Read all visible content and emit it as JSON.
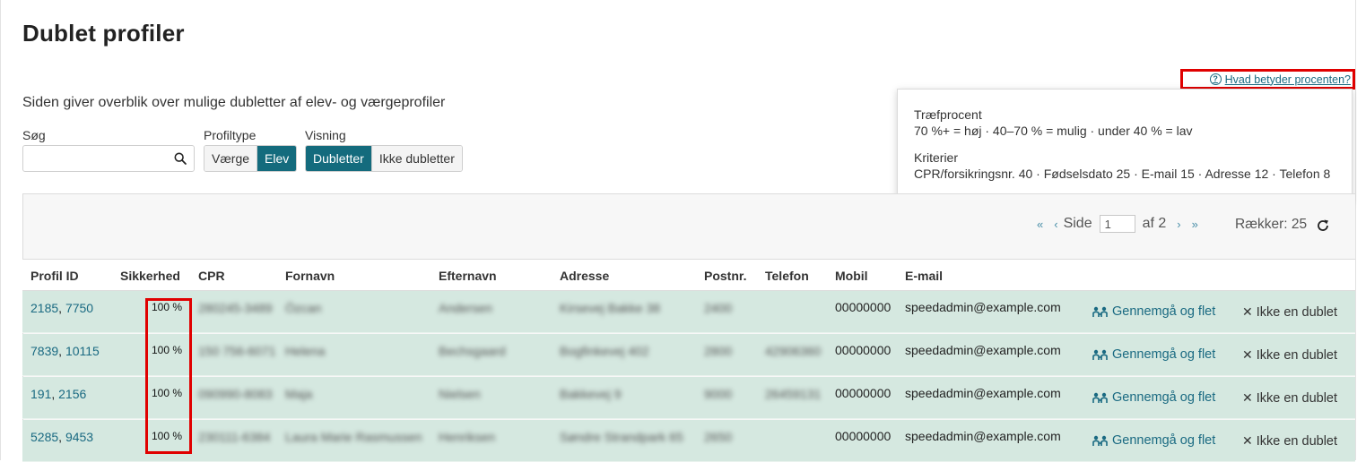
{
  "page": {
    "title": "Dublet profiler",
    "intro": "Siden giver overblik over mulige dubletter af elev- og værgeprofiler",
    "help_link": "Hvad betyder procenten?"
  },
  "tooltip": {
    "heading1": "Træfprocent",
    "line1": "70 %+ = høj · 40–70 % = mulig · under 40 % = lav",
    "heading2": "Kriterier",
    "line2": "CPR/forsikringsnr. 40 · Fødselsdato 25 · E-mail 15 · Adresse 12 · Telefon 8"
  },
  "filters": {
    "search_label": "Søg",
    "search_value": "",
    "profiletype_label": "Profiltype",
    "profiletype_options": [
      "Værge",
      "Elev"
    ],
    "profiletype_selected": "Elev",
    "view_label": "Visning",
    "view_options": [
      "Dubletter",
      "Ikke dubletter"
    ],
    "view_selected": "Dubletter"
  },
  "pager": {
    "first": "«",
    "prev": "‹",
    "page_label": "Side",
    "page_value": "1",
    "of_label": "af 2",
    "next": "›",
    "last": "»",
    "rows_label": "Rækker: 25"
  },
  "table": {
    "headers": [
      "Profil ID",
      "Sikkerhed",
      "CPR",
      "Fornavn",
      "Efternavn",
      "Adresse",
      "Postnr.",
      "Telefon",
      "Mobil",
      "E-mail"
    ],
    "merge_label": "Gennemgå og flet",
    "not_duplicate_label": "Ikke en dublet",
    "rows": [
      {
        "id_a": "2185",
        "id_b": "7750",
        "sikkerhed": "100 %",
        "cpr": "280245-3489",
        "fornavn": "Özcan",
        "efternavn": "Andersen",
        "adresse": "Kirsevej Bakke 38",
        "postnr": "2400",
        "telefon": "",
        "mobil": "00000000",
        "email": "speedadmin@example.com"
      },
      {
        "id_a": "7839",
        "id_b": "10115",
        "sikkerhed": "100 %",
        "cpr": "150 756-6071",
        "fornavn": "Helena",
        "efternavn": "Bechsgaard",
        "adresse": "Bogfinkevej 402",
        "postnr": "2800",
        "telefon": "42906360",
        "mobil": "00000000",
        "email": "speedadmin@example.com"
      },
      {
        "id_a": "191",
        "id_b": "2156",
        "sikkerhed": "100 %",
        "cpr": "090990-8083",
        "fornavn": "Maja",
        "efternavn": "Nielsen",
        "adresse": "Bakkevej 9",
        "postnr": "9000",
        "telefon": "26459131",
        "mobil": "00000000",
        "email": "speedadmin@example.com"
      },
      {
        "id_a": "5285",
        "id_b": "9453",
        "sikkerhed": "100 %",
        "cpr": "230111-6384",
        "fornavn": "Laura Marie Rasmussen",
        "efternavn": "Henriksen",
        "adresse": "Søndre Strandpark 65",
        "postnr": "2650",
        "telefon": "",
        "mobil": "00000000",
        "email": "speedadmin@example.com"
      }
    ]
  },
  "colors": {
    "accent": "#146b7d",
    "link": "#1a6a82",
    "row_bg": "#d5e8e0",
    "highlight": "#e00000"
  },
  "icons": [
    "question-circle-icon",
    "search-icon",
    "refresh-icon",
    "people-merge-icon",
    "close-icon"
  ]
}
